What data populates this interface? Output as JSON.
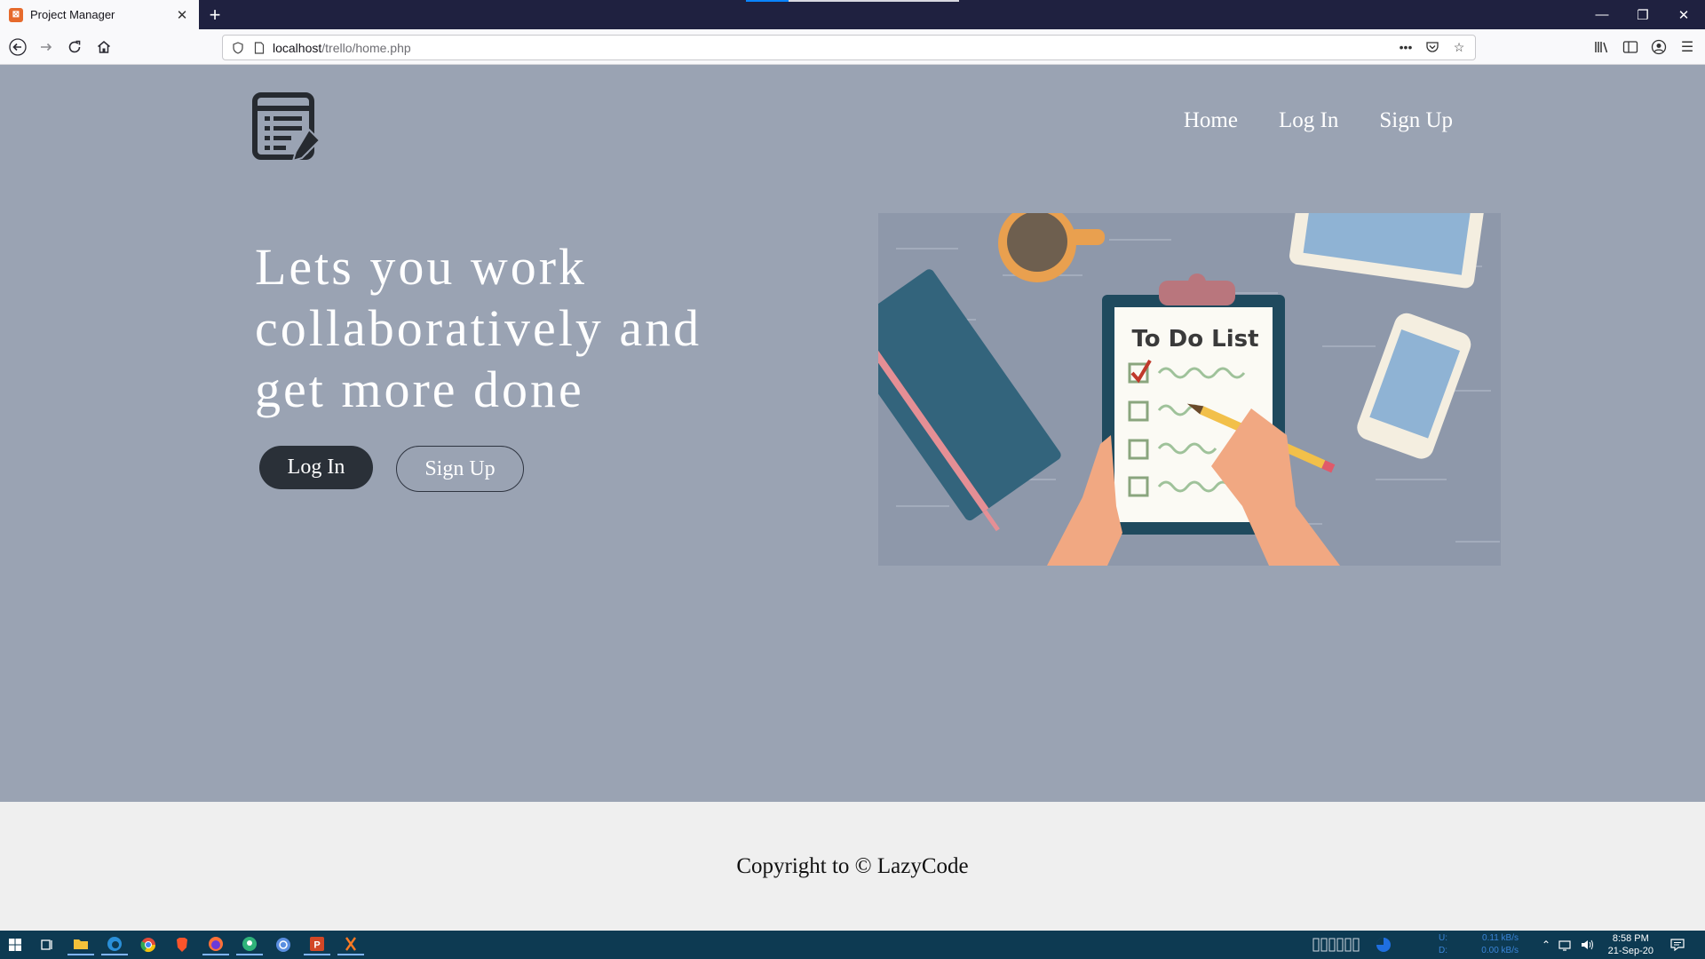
{
  "browser": {
    "tab_title": "Project Manager",
    "new_tab": "+",
    "url_host": "localhost",
    "url_path": "/trello/home.php",
    "url_more": "•••",
    "window_minimize": "—",
    "window_restore": "❐",
    "window_close": "✕"
  },
  "site": {
    "nav": {
      "home": "Home",
      "login": "Log In",
      "signup": "Sign Up"
    },
    "headline": "Lets you work collaboratively and get more done",
    "buttons": {
      "login": "Log In",
      "signup": "Sign Up"
    },
    "illustration_text": "To Do List"
  },
  "footer": {
    "copyright": "Copyright to © LazyCode"
  },
  "taskbar": {
    "net_up_label": "U:",
    "net_up_value": "0.11 kB/s",
    "net_down_label": "D:",
    "net_down_value": "0.00 kB/s",
    "time": "8:58 PM",
    "date": "21-Sep-20"
  },
  "colors": {
    "page_bg": "#9aa3b3",
    "footer_bg": "#efefef",
    "login_btn": "#2a3038",
    "titlebar": "#1f2140",
    "taskbar": "#0d3a52"
  }
}
